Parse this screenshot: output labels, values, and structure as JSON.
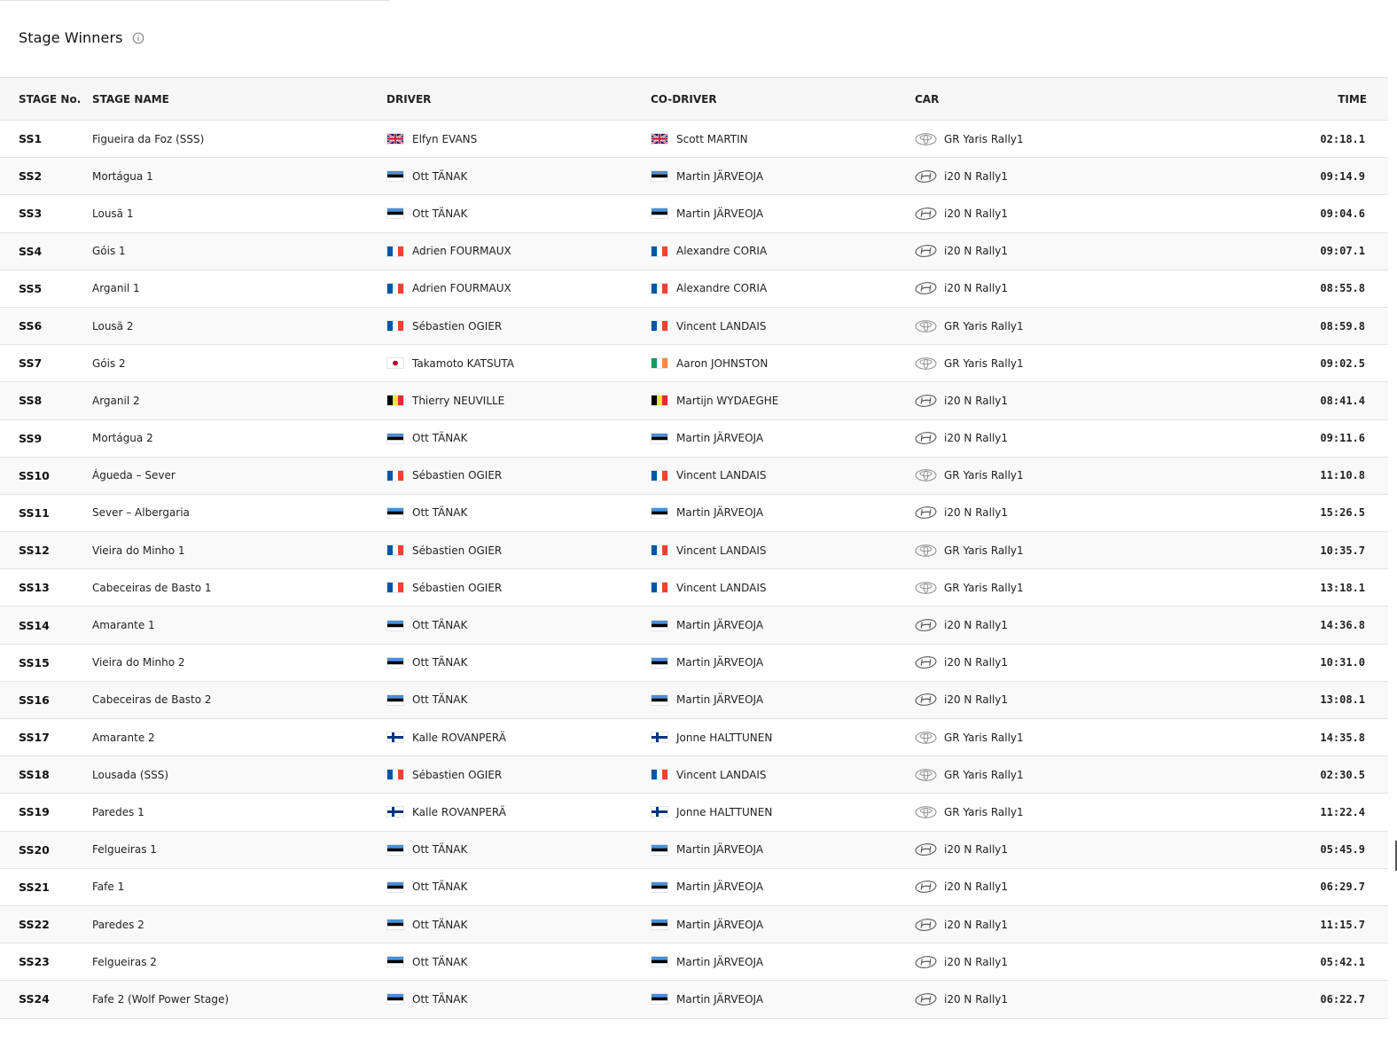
{
  "header": {
    "title": "Stage Winners"
  },
  "table": {
    "columns": [
      "STAGE No.",
      "STAGE NAME",
      "DRIVER",
      "CO-DRIVER",
      "CAR",
      "TIME"
    ],
    "rows": [
      {
        "stage": "SS1",
        "name": "Figueira da Foz (SSS)",
        "driver": "Elfyn EVANS",
        "driver_flag": "gb",
        "codriver": "Scott MARTIN",
        "codriver_flag": "gb",
        "car": "GR Yaris Rally1",
        "brand": "toyota",
        "time": "02:18.1"
      },
      {
        "stage": "SS2",
        "name": "Mortágua 1",
        "driver": "Ott TÄNAK",
        "driver_flag": "ee",
        "codriver": "Martin JÄRVEOJA",
        "codriver_flag": "ee",
        "car": "i20 N Rally1",
        "brand": "hyundai",
        "time": "09:14.9"
      },
      {
        "stage": "SS3",
        "name": "Lousã 1",
        "driver": "Ott TÄNAK",
        "driver_flag": "ee",
        "codriver": "Martin JÄRVEOJA",
        "codriver_flag": "ee",
        "car": "i20 N Rally1",
        "brand": "hyundai",
        "time": "09:04.6"
      },
      {
        "stage": "SS4",
        "name": "Góis 1",
        "driver": "Adrien FOURMAUX",
        "driver_flag": "fr",
        "codriver": "Alexandre CORIA",
        "codriver_flag": "fr",
        "car": "i20 N Rally1",
        "brand": "hyundai",
        "time": "09:07.1"
      },
      {
        "stage": "SS5",
        "name": "Arganil 1",
        "driver": "Adrien FOURMAUX",
        "driver_flag": "fr",
        "codriver": "Alexandre CORIA",
        "codriver_flag": "fr",
        "car": "i20 N Rally1",
        "brand": "hyundai",
        "time": "08:55.8"
      },
      {
        "stage": "SS6",
        "name": "Lousã 2",
        "driver": "Sébastien OGIER",
        "driver_flag": "fr",
        "codriver": "Vincent LANDAIS",
        "codriver_flag": "fr",
        "car": "GR Yaris Rally1",
        "brand": "toyota",
        "time": "08:59.8"
      },
      {
        "stage": "SS7",
        "name": "Góis 2",
        "driver": "Takamoto KATSUTA",
        "driver_flag": "jp",
        "codriver": "Aaron JOHNSTON",
        "codriver_flag": "ie",
        "car": "GR Yaris Rally1",
        "brand": "toyota",
        "time": "09:02.5"
      },
      {
        "stage": "SS8",
        "name": "Arganil 2",
        "driver": "Thierry NEUVILLE",
        "driver_flag": "be",
        "codriver": "Martijn WYDAEGHE",
        "codriver_flag": "be",
        "car": "i20 N Rally1",
        "brand": "hyundai",
        "time": "08:41.4"
      },
      {
        "stage": "SS9",
        "name": "Mortágua 2",
        "driver": "Ott TÄNAK",
        "driver_flag": "ee",
        "codriver": "Martin JÄRVEOJA",
        "codriver_flag": "ee",
        "car": "i20 N Rally1",
        "brand": "hyundai",
        "time": "09:11.6"
      },
      {
        "stage": "SS10",
        "name": "Águeda – Sever",
        "driver": "Sébastien OGIER",
        "driver_flag": "fr",
        "codriver": "Vincent LANDAIS",
        "codriver_flag": "fr",
        "car": "GR Yaris Rally1",
        "brand": "toyota",
        "time": "11:10.8"
      },
      {
        "stage": "SS11",
        "name": "Sever – Albergaria",
        "driver": "Ott TÄNAK",
        "driver_flag": "ee",
        "codriver": "Martin JÄRVEOJA",
        "codriver_flag": "ee",
        "car": "i20 N Rally1",
        "brand": "hyundai",
        "time": "15:26.5"
      },
      {
        "stage": "SS12",
        "name": "Vieira do Minho 1",
        "driver": "Sébastien OGIER",
        "driver_flag": "fr",
        "codriver": "Vincent LANDAIS",
        "codriver_flag": "fr",
        "car": "GR Yaris Rally1",
        "brand": "toyota",
        "time": "10:35.7"
      },
      {
        "stage": "SS13",
        "name": "Cabeceiras de Basto 1",
        "driver": "Sébastien OGIER",
        "driver_flag": "fr",
        "codriver": "Vincent LANDAIS",
        "codriver_flag": "fr",
        "car": "GR Yaris Rally1",
        "brand": "toyota",
        "time": "13:18.1"
      },
      {
        "stage": "SS14",
        "name": "Amarante 1",
        "driver": "Ott TÄNAK",
        "driver_flag": "ee",
        "codriver": "Martin JÄRVEOJA",
        "codriver_flag": "ee",
        "car": "i20 N Rally1",
        "brand": "hyundai",
        "time": "14:36.8"
      },
      {
        "stage": "SS15",
        "name": "Vieira do Minho 2",
        "driver": "Ott TÄNAK",
        "driver_flag": "ee",
        "codriver": "Martin JÄRVEOJA",
        "codriver_flag": "ee",
        "car": "i20 N Rally1",
        "brand": "hyundai",
        "time": "10:31.0"
      },
      {
        "stage": "SS16",
        "name": "Cabeceiras de Basto 2",
        "driver": "Ott TÄNAK",
        "driver_flag": "ee",
        "codriver": "Martin JÄRVEOJA",
        "codriver_flag": "ee",
        "car": "i20 N Rally1",
        "brand": "hyundai",
        "time": "13:08.1"
      },
      {
        "stage": "SS17",
        "name": "Amarante 2",
        "driver": "Kalle ROVANPERÄ",
        "driver_flag": "fi",
        "codriver": "Jonne HALTTUNEN",
        "codriver_flag": "fi",
        "car": "GR Yaris Rally1",
        "brand": "toyota",
        "time": "14:35.8"
      },
      {
        "stage": "SS18",
        "name": "Lousada (SSS)",
        "driver": "Sébastien OGIER",
        "driver_flag": "fr",
        "codriver": "Vincent LANDAIS",
        "codriver_flag": "fr",
        "car": "GR Yaris Rally1",
        "brand": "toyota",
        "time": "02:30.5"
      },
      {
        "stage": "SS19",
        "name": "Paredes 1",
        "driver": "Kalle ROVANPERÄ",
        "driver_flag": "fi",
        "codriver": "Jonne HALTTUNEN",
        "codriver_flag": "fi",
        "car": "GR Yaris Rally1",
        "brand": "toyota",
        "time": "11:22.4"
      },
      {
        "stage": "SS20",
        "name": "Felgueiras 1",
        "driver": "Ott TÄNAK",
        "driver_flag": "ee",
        "codriver": "Martin JÄRVEOJA",
        "codriver_flag": "ee",
        "car": "i20 N Rally1",
        "brand": "hyundai",
        "time": "05:45.9"
      },
      {
        "stage": "SS21",
        "name": "Fafe 1",
        "driver": "Ott TÄNAK",
        "driver_flag": "ee",
        "codriver": "Martin JÄRVEOJA",
        "codriver_flag": "ee",
        "car": "i20 N Rally1",
        "brand": "hyundai",
        "time": "06:29.7"
      },
      {
        "stage": "SS22",
        "name": "Paredes 2",
        "driver": "Ott TÄNAK",
        "driver_flag": "ee",
        "codriver": "Martin JÄRVEOJA",
        "codriver_flag": "ee",
        "car": "i20 N Rally1",
        "brand": "hyundai",
        "time": "11:15.7"
      },
      {
        "stage": "SS23",
        "name": "Felgueiras 2",
        "driver": "Ott TÄNAK",
        "driver_flag": "ee",
        "codriver": "Martin JÄRVEOJA",
        "codriver_flag": "ee",
        "car": "i20 N Rally1",
        "brand": "hyundai",
        "time": "05:42.1"
      },
      {
        "stage": "SS24",
        "name": "Fafe 2 (Wolf Power Stage)",
        "driver": "Ott TÄNAK",
        "driver_flag": "ee",
        "codriver": "Martin JÄRVEOJA",
        "codriver_flag": "ee",
        "car": "i20 N Rally1",
        "brand": "hyundai",
        "time": "06:22.7"
      }
    ]
  },
  "colors": {
    "text": "#111111",
    "row_alt": "#f9f9f9",
    "header_bg": "#f7f7f7",
    "border": "#e4e4e4"
  }
}
